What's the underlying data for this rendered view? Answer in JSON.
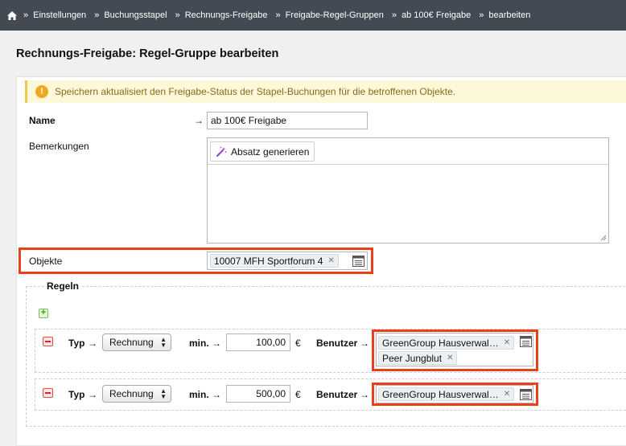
{
  "breadcrumb": {
    "items": [
      "Einstellungen",
      "Buchungsstapel",
      "Rechnungs-Freigabe",
      "Freigabe-Regel-Gruppen",
      "ab 100€ Freigabe",
      "bearbeiten"
    ],
    "separator": "»",
    "home_icon": "home-icon"
  },
  "page": {
    "title": "Rechnungs-Freigabe: Regel-Gruppe bearbeiten"
  },
  "warning": {
    "text": "Speichern aktualisiert den Freigabe-Status der Stapel-Buchungen für die betroffenen Objekte.",
    "icon": "warning-icon"
  },
  "form": {
    "name_label": "Name",
    "name_value": "ab 100€ Freigabe",
    "remarks_label": "Bemerkungen",
    "generate_button": "Absatz generieren",
    "objects_label": "Objekte",
    "objects_tags": [
      "10007 MFH Sportforum 4"
    ],
    "arrow": "→"
  },
  "rules": {
    "legend": "Regeln",
    "add_label": "+",
    "type_label": "Typ",
    "min_label": "min.",
    "users_label": "Benutzer",
    "currency": "€",
    "items": [
      {
        "type": "Rechnung",
        "min": "100,00",
        "users": [
          "GreenGroup Hausverwal…",
          "Peer Jungblut"
        ]
      },
      {
        "type": "Rechnung",
        "min": "500,00",
        "users": [
          "GreenGroup Hausverwal…"
        ]
      }
    ]
  },
  "colors": {
    "topbar": "#434a54",
    "highlight": "#e8401c",
    "warning_bg": "#fcf8d8",
    "warning_icon": "#f0a821"
  }
}
